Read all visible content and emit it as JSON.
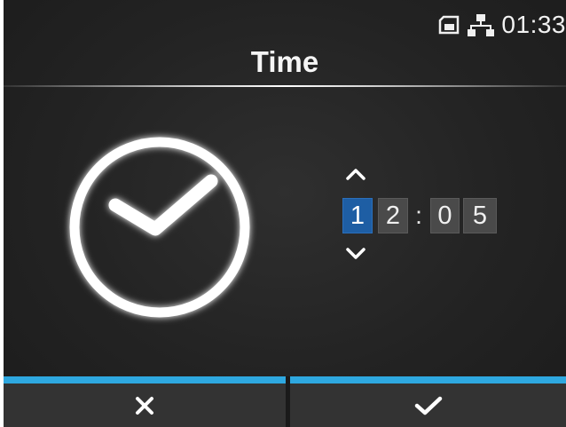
{
  "status_bar": {
    "time": "01:33",
    "icons": [
      "sd-card-icon",
      "network-icon"
    ]
  },
  "title": "Time",
  "clock": {
    "icon": "clock-check-icon",
    "digits": [
      "1",
      "2",
      "0",
      "5"
    ],
    "separator": ":",
    "selected_digit_index": 0,
    "up_icon": "chevron-up-icon",
    "down_icon": "chevron-down-icon"
  },
  "buttons": {
    "cancel_icon": "close-icon",
    "confirm_icon": "check-icon"
  },
  "colors": {
    "background": "#232323",
    "accent_bar": "#2ea8e0",
    "selected_digit": "#1e5ea4",
    "digit_box": "#4a4a4a",
    "button_bg": "#333333"
  }
}
